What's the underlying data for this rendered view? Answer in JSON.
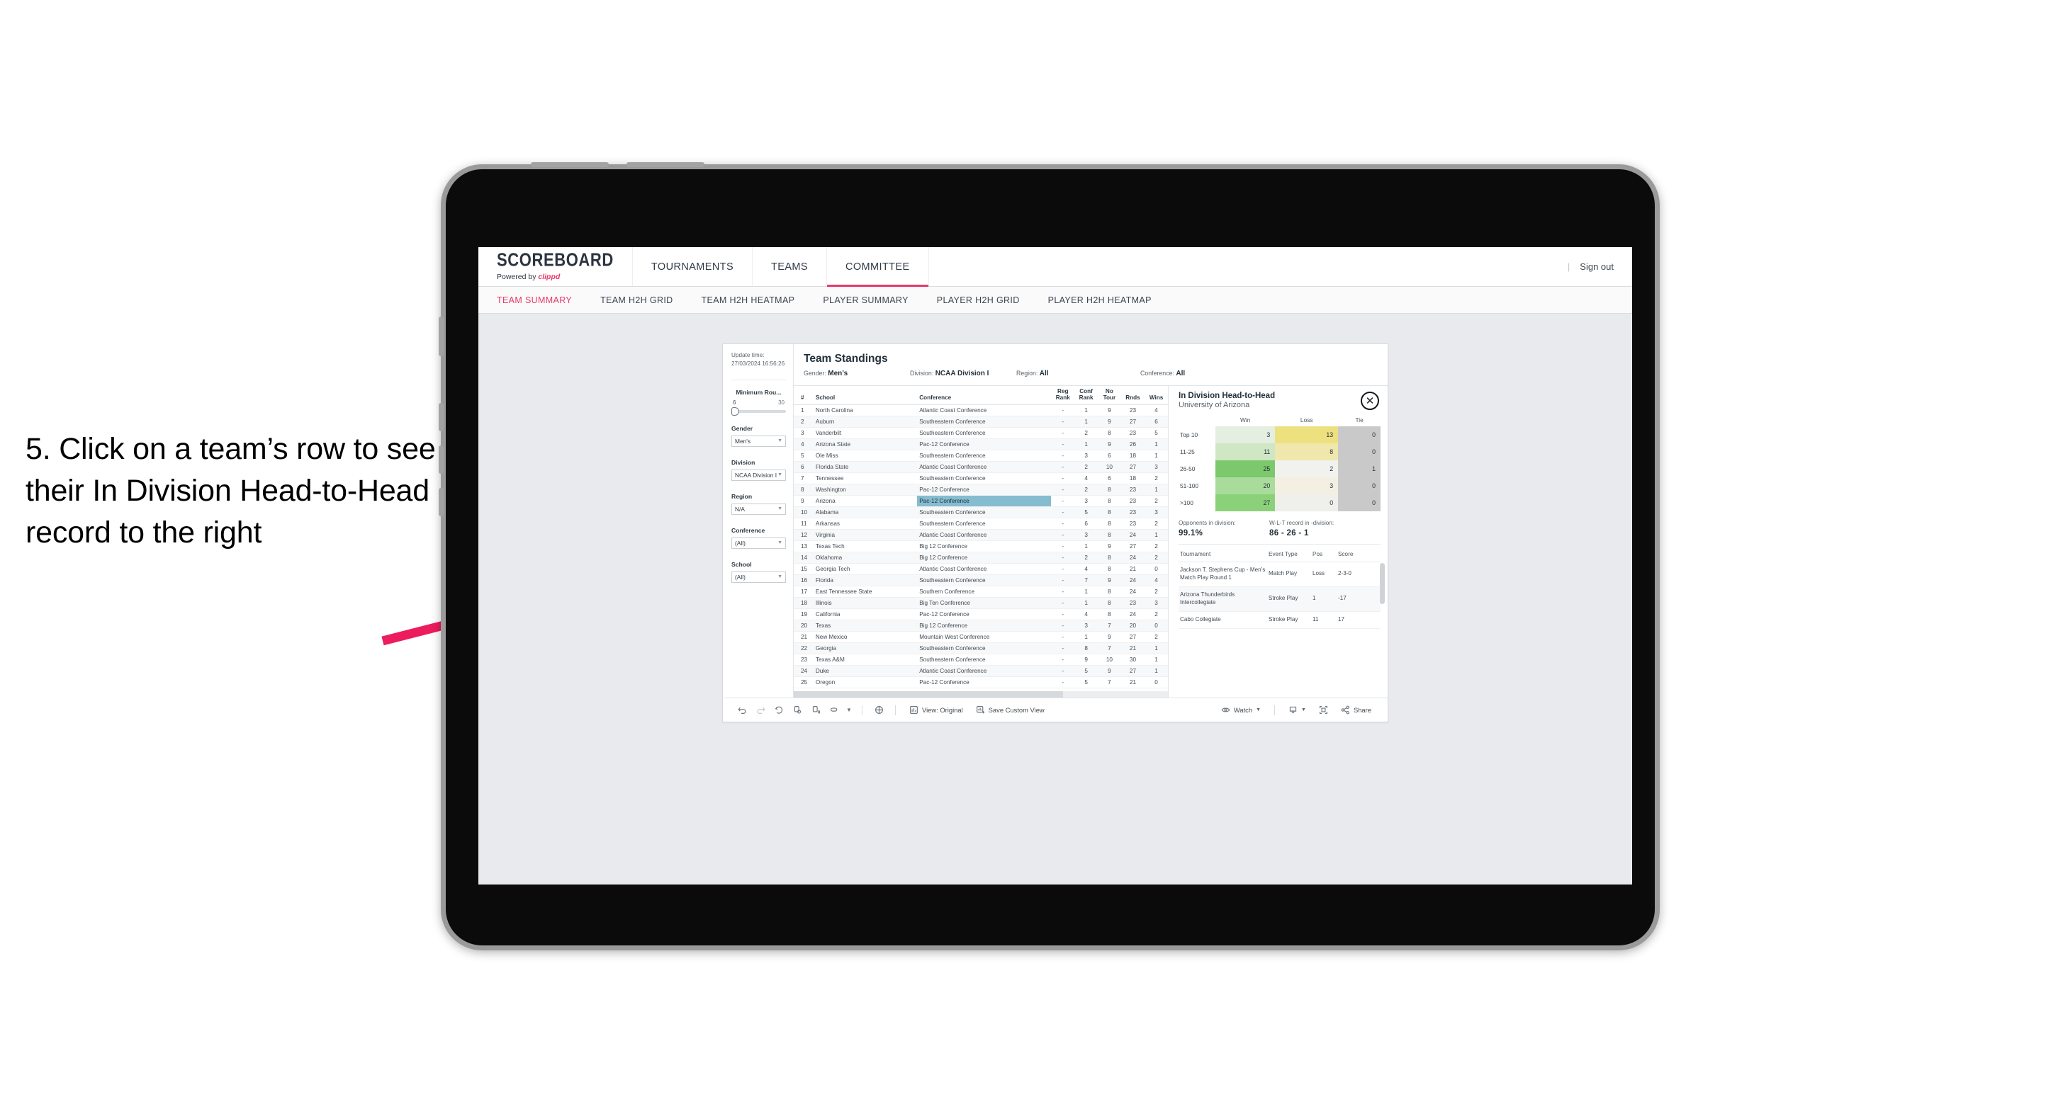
{
  "annotation": {
    "text": "5. Click on a team’s row to see their In Division Head-to-Head record to the right",
    "arrow_color": "#ec1c5e"
  },
  "header": {
    "brand_title": "SCOREBOARD",
    "brand_sub_prefix": "Powered by",
    "brand_sub_name": "clippd",
    "nav": [
      {
        "label": "TOURNAMENTS",
        "active": false
      },
      {
        "label": "TEAMS",
        "active": false
      },
      {
        "label": "COMMITTEE",
        "active": true
      }
    ],
    "divider": "|",
    "sign_out": "Sign out",
    "accent_color": "#e8386b"
  },
  "sub_nav": [
    {
      "label": "TEAM SUMMARY",
      "active": true
    },
    {
      "label": "TEAM H2H GRID",
      "active": false
    },
    {
      "label": "TEAM H2H HEATMAP",
      "active": false
    },
    {
      "label": "PLAYER SUMMARY",
      "active": false
    },
    {
      "label": "PLAYER H2H GRID",
      "active": false
    },
    {
      "label": "PLAYER H2H HEATMAP",
      "active": false
    }
  ],
  "filters": {
    "update_time_label": "Update time:",
    "update_time_value": "27/03/2024 16:56:26",
    "min_rounds": {
      "label": "Minimum Rou...",
      "min": "6",
      "max": "30"
    },
    "gender": {
      "label": "Gender",
      "value": "Men's"
    },
    "division": {
      "label": "Division",
      "value": "NCAA Division I"
    },
    "region": {
      "label": "Region",
      "value": "N/A"
    },
    "conference": {
      "label": "Conference",
      "value": "(All)"
    },
    "school": {
      "label": "School",
      "value": "(All)"
    }
  },
  "standings": {
    "title": "Team Standings",
    "meta": [
      {
        "label": "Gender:",
        "value": "Men’s"
      },
      {
        "label": "Division:",
        "value": "NCAA Division I"
      },
      {
        "label": "Region:",
        "value": "All"
      },
      {
        "label": "Conference:",
        "value": "All"
      }
    ],
    "columns": [
      "#",
      "School",
      "Conference",
      "Reg Rank",
      "Conf Rank",
      "No Tour",
      "Rnds",
      "Wins"
    ],
    "rows": [
      {
        "rank": "1",
        "school": "North Carolina",
        "conference": "Atlantic Coast Conference",
        "reg_rank": "-",
        "conf_rank": "1",
        "no_tour": "9",
        "rnds": "23",
        "wins": "4",
        "highlight": false
      },
      {
        "rank": "2",
        "school": "Auburn",
        "conference": "Southeastern Conference",
        "reg_rank": "-",
        "conf_rank": "1",
        "no_tour": "9",
        "rnds": "27",
        "wins": "6",
        "highlight": false
      },
      {
        "rank": "3",
        "school": "Vanderbilt",
        "conference": "Southeastern Conference",
        "reg_rank": "-",
        "conf_rank": "2",
        "no_tour": "8",
        "rnds": "23",
        "wins": "5",
        "highlight": false
      },
      {
        "rank": "4",
        "school": "Arizona State",
        "conference": "Pac-12 Conference",
        "reg_rank": "-",
        "conf_rank": "1",
        "no_tour": "9",
        "rnds": "26",
        "wins": "1",
        "highlight": false
      },
      {
        "rank": "5",
        "school": "Ole Miss",
        "conference": "Southeastern Conference",
        "reg_rank": "-",
        "conf_rank": "3",
        "no_tour": "6",
        "rnds": "18",
        "wins": "1",
        "highlight": false
      },
      {
        "rank": "6",
        "school": "Florida State",
        "conference": "Atlantic Coast Conference",
        "reg_rank": "-",
        "conf_rank": "2",
        "no_tour": "10",
        "rnds": "27",
        "wins": "3",
        "highlight": false
      },
      {
        "rank": "7",
        "school": "Tennessee",
        "conference": "Southeastern Conference",
        "reg_rank": "-",
        "conf_rank": "4",
        "no_tour": "6",
        "rnds": "18",
        "wins": "2",
        "highlight": false
      },
      {
        "rank": "8",
        "school": "Washington",
        "conference": "Pac-12 Conference",
        "reg_rank": "-",
        "conf_rank": "2",
        "no_tour": "8",
        "rnds": "23",
        "wins": "1",
        "highlight": false
      },
      {
        "rank": "9",
        "school": "Arizona",
        "conference": "Pac-12 Conference",
        "reg_rank": "-",
        "conf_rank": "3",
        "no_tour": "8",
        "rnds": "23",
        "wins": "2",
        "highlight": true
      },
      {
        "rank": "10",
        "school": "Alabama",
        "conference": "Southeastern Conference",
        "reg_rank": "-",
        "conf_rank": "5",
        "no_tour": "8",
        "rnds": "23",
        "wins": "3",
        "highlight": false
      },
      {
        "rank": "11",
        "school": "Arkansas",
        "conference": "Southeastern Conference",
        "reg_rank": "-",
        "conf_rank": "6",
        "no_tour": "8",
        "rnds": "23",
        "wins": "2",
        "highlight": false
      },
      {
        "rank": "12",
        "school": "Virginia",
        "conference": "Atlantic Coast Conference",
        "reg_rank": "-",
        "conf_rank": "3",
        "no_tour": "8",
        "rnds": "24",
        "wins": "1",
        "highlight": false
      },
      {
        "rank": "13",
        "school": "Texas Tech",
        "conference": "Big 12 Conference",
        "reg_rank": "-",
        "conf_rank": "1",
        "no_tour": "9",
        "rnds": "27",
        "wins": "2",
        "highlight": false
      },
      {
        "rank": "14",
        "school": "Oklahoma",
        "conference": "Big 12 Conference",
        "reg_rank": "-",
        "conf_rank": "2",
        "no_tour": "8",
        "rnds": "24",
        "wins": "2",
        "highlight": false
      },
      {
        "rank": "15",
        "school": "Georgia Tech",
        "conference": "Atlantic Coast Conference",
        "reg_rank": "-",
        "conf_rank": "4",
        "no_tour": "8",
        "rnds": "21",
        "wins": "0",
        "highlight": false
      },
      {
        "rank": "16",
        "school": "Florida",
        "conference": "Southeastern Conference",
        "reg_rank": "-",
        "conf_rank": "7",
        "no_tour": "9",
        "rnds": "24",
        "wins": "4",
        "highlight": false
      },
      {
        "rank": "17",
        "school": "East Tennessee State",
        "conference": "Southern Conference",
        "reg_rank": "-",
        "conf_rank": "1",
        "no_tour": "8",
        "rnds": "24",
        "wins": "2",
        "highlight": false
      },
      {
        "rank": "18",
        "school": "Illinois",
        "conference": "Big Ten Conference",
        "reg_rank": "-",
        "conf_rank": "1",
        "no_tour": "8",
        "rnds": "23",
        "wins": "3",
        "highlight": false
      },
      {
        "rank": "19",
        "school": "California",
        "conference": "Pac-12 Conference",
        "reg_rank": "-",
        "conf_rank": "4",
        "no_tour": "8",
        "rnds": "24",
        "wins": "2",
        "highlight": false
      },
      {
        "rank": "20",
        "school": "Texas",
        "conference": "Big 12 Conference",
        "reg_rank": "-",
        "conf_rank": "3",
        "no_tour": "7",
        "rnds": "20",
        "wins": "0",
        "highlight": false
      },
      {
        "rank": "21",
        "school": "New Mexico",
        "conference": "Mountain West Conference",
        "reg_rank": "-",
        "conf_rank": "1",
        "no_tour": "9",
        "rnds": "27",
        "wins": "2",
        "highlight": false
      },
      {
        "rank": "22",
        "school": "Georgia",
        "conference": "Southeastern Conference",
        "reg_rank": "-",
        "conf_rank": "8",
        "no_tour": "7",
        "rnds": "21",
        "wins": "1",
        "highlight": false
      },
      {
        "rank": "23",
        "school": "Texas A&M",
        "conference": "Southeastern Conference",
        "reg_rank": "-",
        "conf_rank": "9",
        "no_tour": "10",
        "rnds": "30",
        "wins": "1",
        "highlight": false
      },
      {
        "rank": "24",
        "school": "Duke",
        "conference": "Atlantic Coast Conference",
        "reg_rank": "-",
        "conf_rank": "5",
        "no_tour": "9",
        "rnds": "27",
        "wins": "1",
        "highlight": false
      },
      {
        "rank": "25",
        "school": "Oregon",
        "conference": "Pac-12 Conference",
        "reg_rank": "-",
        "conf_rank": "5",
        "no_tour": "7",
        "rnds": "21",
        "wins": "0",
        "highlight": false
      }
    ],
    "highlight_color": "#86bcd0"
  },
  "h2h": {
    "title": "In Division Head-to-Head",
    "subtitle": "University of Arizona",
    "close_icon": "✕",
    "chart_data": {
      "type": "heatmap",
      "title": "In Division Head-to-Head",
      "columns": [
        "Win",
        "Loss",
        "Tie"
      ],
      "categories": [
        "Top 10",
        "11-25",
        "26-50",
        "51-100",
        ">100"
      ],
      "series": [
        {
          "name": "Win",
          "values": [
            3,
            11,
            25,
            20,
            27
          ]
        },
        {
          "name": "Loss",
          "values": [
            13,
            8,
            2,
            3,
            0
          ]
        },
        {
          "name": "Tie",
          "values": [
            0,
            0,
            1,
            0,
            0
          ]
        }
      ],
      "cell_colors": {
        "win": [
          "#e4eee1",
          "#cfe7c4",
          "#7cc86d",
          "#a9dc9b",
          "#8bd179"
        ],
        "loss": [
          "#ede07f",
          "#f0e7ad",
          "#f1f1ee",
          "#f3efe2",
          "#efefec"
        ],
        "tie": [
          "#c9c9c9",
          "#c9c9c9",
          "#c9c9c9",
          "#c9c9c9",
          "#c9c9c9"
        ]
      },
      "legend": "none",
      "grid": false
    },
    "stats": [
      {
        "label": "Opponents in division:",
        "value": "99.1%"
      },
      {
        "label": "W-L-T record in -division:",
        "value": "86 - 26 - 1"
      }
    ],
    "events_columns": [
      "Tournament",
      "Event Type",
      "Pos",
      "Score"
    ],
    "events": [
      {
        "tournament": "Jackson T. Stephens Cup - Men’s Match Play Round 1",
        "event_type": "Match Play",
        "pos": "Loss",
        "score": "2-3-0"
      },
      {
        "tournament": "Arizona Thunderbirds Intercollegiate",
        "event_type": "Stroke Play",
        "pos": "1",
        "score": "-17"
      },
      {
        "tournament": "Cabo Collegiate",
        "event_type": "Stroke Play",
        "pos": "11",
        "score": "17"
      }
    ]
  },
  "toolbar": {
    "icons": [
      "undo-icon",
      "redo-icon",
      "revert-icon",
      "refresh-icon",
      "pause-icon",
      "rect-select-icon",
      "chevron-down-icon"
    ],
    "share_divider": "|",
    "view_label": "View: Original",
    "save_label": "Save Custom View",
    "watch_label": "Watch",
    "share_label": "Share"
  }
}
